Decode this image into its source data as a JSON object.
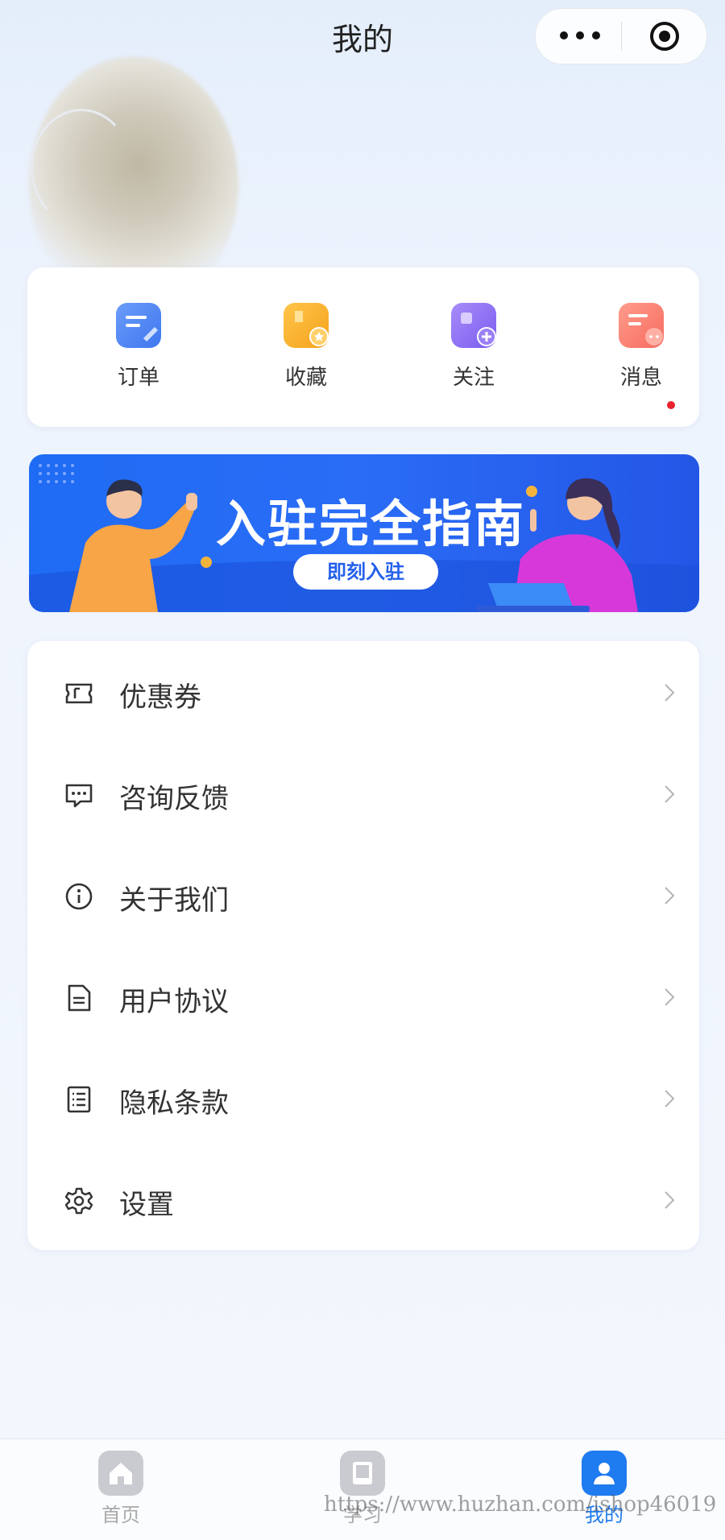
{
  "header": {
    "title": "我的"
  },
  "capsule": {
    "more_icon": "more-dots-icon",
    "close_icon": "target-circle-icon"
  },
  "quick_actions": [
    {
      "label": "订单",
      "icon": "order-icon",
      "color": "#4a83f5"
    },
    {
      "label": "收藏",
      "icon": "favorite-icon",
      "color": "#f7a823"
    },
    {
      "label": "关注",
      "icon": "follow-icon",
      "color": "#8a6cf3"
    },
    {
      "label": "消息",
      "icon": "message-icon",
      "color": "#f77566",
      "badge": true
    }
  ],
  "banner": {
    "title": "入驻完全指南",
    "button_label": "即刻入驻"
  },
  "menu": [
    {
      "label": "优惠券",
      "icon": "coupon-icon"
    },
    {
      "label": "咨询反馈",
      "icon": "feedback-chat-icon"
    },
    {
      "label": "关于我们",
      "icon": "info-icon"
    },
    {
      "label": "用户协议",
      "icon": "document-icon"
    },
    {
      "label": "隐私条款",
      "icon": "list-document-icon"
    },
    {
      "label": "设置",
      "icon": "gear-icon"
    }
  ],
  "tabbar": [
    {
      "label": "首页",
      "icon": "home-icon",
      "active": false
    },
    {
      "label": "学习",
      "icon": "book-icon",
      "active": false
    },
    {
      "label": "我的",
      "icon": "user-icon",
      "active": true
    }
  ],
  "watermark": "https://www.huzhan.com/ishop46019",
  "colors": {
    "accent": "#1f7bf0",
    "badge": "#e8232e",
    "banner_bg": "#2464f0"
  }
}
